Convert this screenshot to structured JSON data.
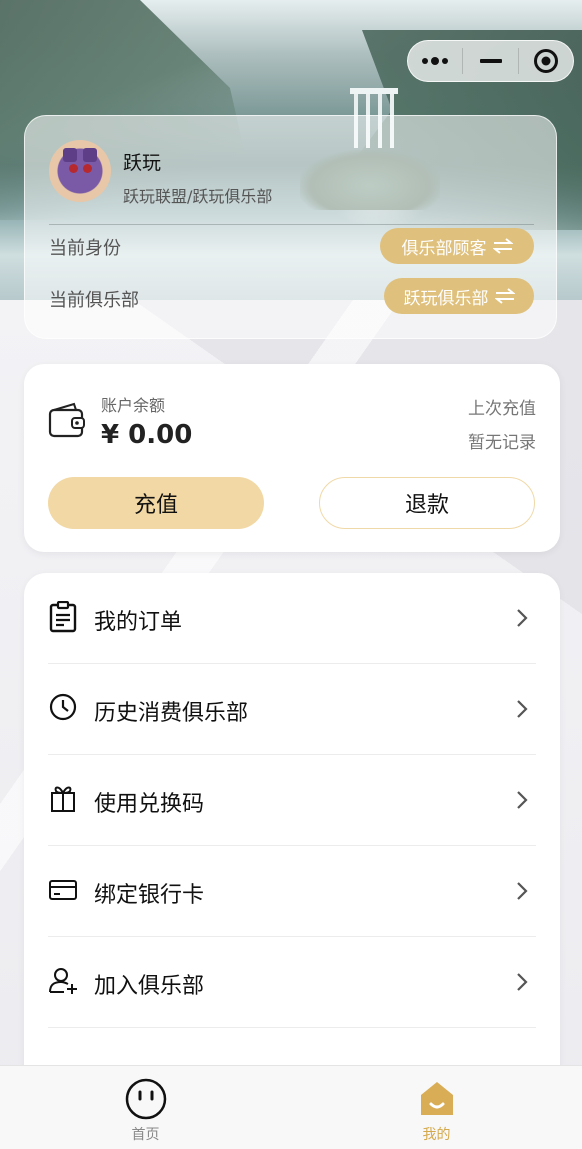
{
  "capsule": {
    "more_icon": "more-dots-icon",
    "minimize_icon": "minus-icon",
    "close_icon": "target-circle-icon"
  },
  "profile": {
    "name": "跃玩",
    "organization": "跃玩联盟/跃玩俱乐部",
    "identity_label": "当前身份",
    "identity_value": "俱乐部顾客",
    "club_label": "当前俱乐部",
    "club_value": "跃玩俱乐部",
    "switch_icon": "switch-arrows-icon",
    "accent_color": "#dfc07c"
  },
  "balance": {
    "label": "账户余额",
    "value": "¥ 0.00",
    "last_recharge_label": "上次充值",
    "last_recharge_value": "暂无记录",
    "recharge_button": "充值",
    "refund_button": "退款",
    "recharge_color": "#f2d8a4"
  },
  "menu": {
    "items": [
      {
        "label": "我的订单",
        "icon": "clipboard-icon"
      },
      {
        "label": "历史消费俱乐部",
        "icon": "clock-icon"
      },
      {
        "label": "使用兑换码",
        "icon": "gift-icon"
      },
      {
        "label": "绑定银行卡",
        "icon": "credit-card-icon"
      },
      {
        "label": "加入俱乐部",
        "icon": "add-user-icon"
      }
    ]
  },
  "tabbar": {
    "tabs": [
      {
        "label": "首页",
        "icon": "smiley-face-icon",
        "active": false
      },
      {
        "label": "我的",
        "icon": "home-icon",
        "active": true
      }
    ],
    "active_color": "#d4a94b",
    "inactive_color": "#888888"
  }
}
